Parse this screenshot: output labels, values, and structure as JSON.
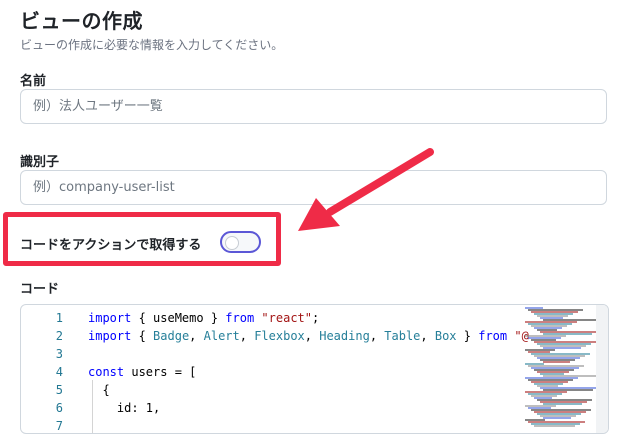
{
  "page": {
    "title": "ビューの作成",
    "description": "ビューの作成に必要な情報を入力してください。"
  },
  "form": {
    "name_label": "名前",
    "name_placeholder": "例）法人ユーザー一覧",
    "identifier_label": "識別子",
    "identifier_placeholder": "例）company-user-list",
    "toggle_label": "コードをアクションで取得する",
    "toggle_on": false,
    "code_label": "コード"
  },
  "code_editor": {
    "lines": [
      {
        "num": "1",
        "text": "import { useMemo } from \"react\";"
      },
      {
        "num": "2",
        "text": "import { Badge, Alert, Flexbox, Heading, Table, Box } from \"@"
      },
      {
        "num": "3",
        "text": ""
      },
      {
        "num": "4",
        "text": "const users = ["
      },
      {
        "num": "5",
        "text": "  {"
      },
      {
        "num": "6",
        "text": "    id: 1,"
      },
      {
        "num": "7",
        "text": ""
      }
    ]
  },
  "annotation": {
    "arrow_color": "#ef2b47",
    "highlight_color": "#ef2b47"
  },
  "colors": {
    "toggle_border": "#5b57d6",
    "keyword": "#0000ff",
    "string": "#a31515"
  }
}
